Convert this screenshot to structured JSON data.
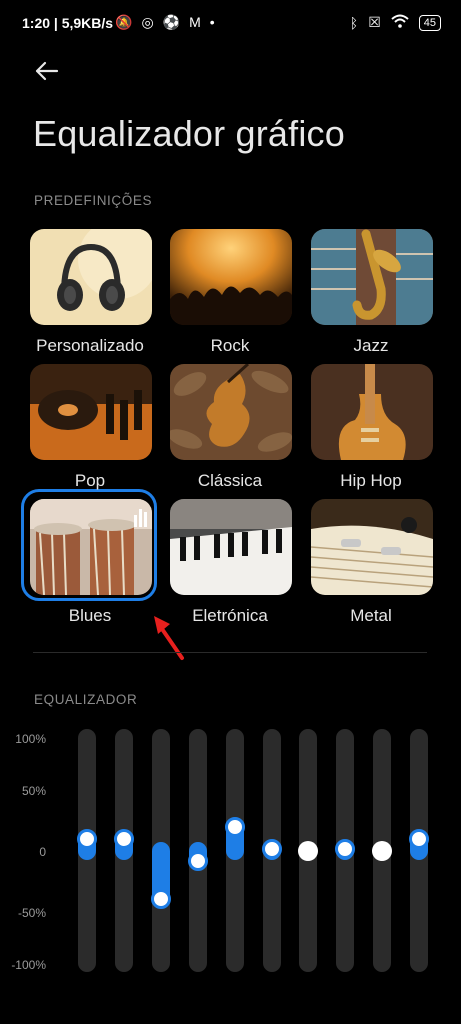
{
  "status_bar": {
    "time": "1:20 | 5,9KB/s",
    "battery": "45"
  },
  "page": {
    "title": "Equalizador gráfico"
  },
  "presets": {
    "section_label": "PREDEFINIÇÕES",
    "selected": "Blues",
    "items": [
      {
        "label": "Personalizado"
      },
      {
        "label": "Rock"
      },
      {
        "label": "Jazz"
      },
      {
        "label": "Pop"
      },
      {
        "label": "Clássica"
      },
      {
        "label": "Hip Hop"
      },
      {
        "label": "Blues"
      },
      {
        "label": "Eletrónica"
      },
      {
        "label": "Metal"
      }
    ]
  },
  "equalizer": {
    "section_label": "EQUALIZADOR",
    "y_labels": [
      "100%",
      "50%",
      "0",
      "-50%",
      "-100%"
    ],
    "bands_percent": [
      10,
      10,
      -40,
      -8,
      20,
      2,
      0,
      2,
      0,
      10
    ]
  },
  "colors": {
    "accent": "#1e7ee6",
    "background": "#000000"
  }
}
